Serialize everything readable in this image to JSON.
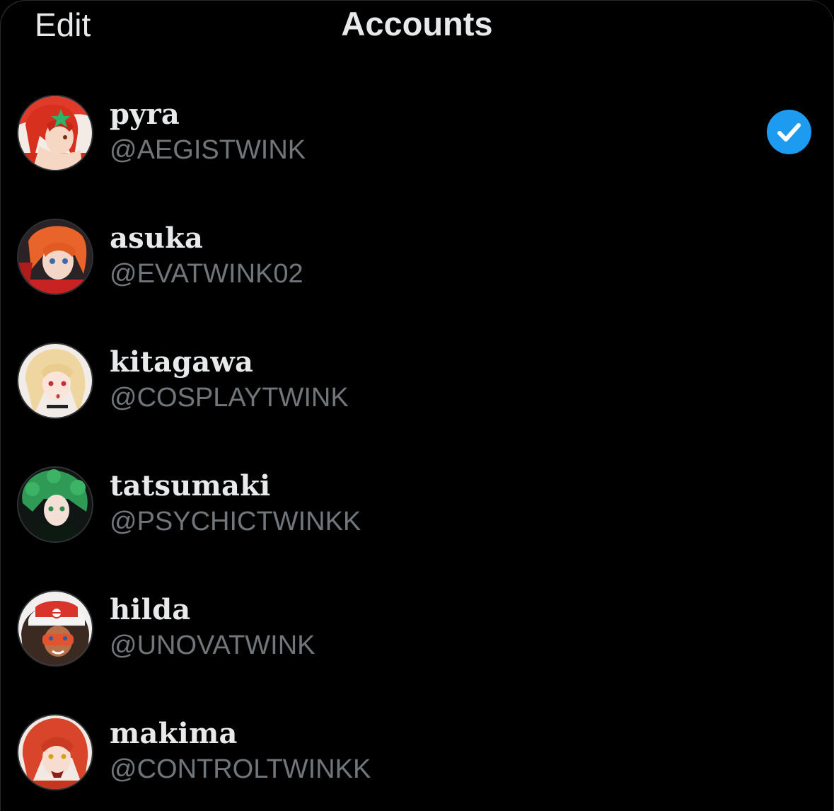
{
  "header": {
    "edit_label": "Edit",
    "title": "Accounts"
  },
  "colors": {
    "background": "#000000",
    "primary_text": "#e7e9ea",
    "secondary_text": "#71767b",
    "accent": "#1d9bf0"
  },
  "accounts": [
    {
      "name": "pyra",
      "handle": "@AEGISTWINK",
      "selected": true,
      "avatar_icon": "pyra-avatar"
    },
    {
      "name": "asuka",
      "handle": "@EVATWINK02",
      "selected": false,
      "avatar_icon": "asuka-avatar"
    },
    {
      "name": "kitagawa",
      "handle": "@COSPLAYTWINK",
      "selected": false,
      "avatar_icon": "kitagawa-avatar"
    },
    {
      "name": "tatsumaki",
      "handle": "@PSYCHICTWINKK",
      "selected": false,
      "avatar_icon": "tatsumaki-avatar"
    },
    {
      "name": "hilda",
      "handle": "@UNOVATWINK",
      "selected": false,
      "avatar_icon": "hilda-avatar"
    },
    {
      "name": "makima",
      "handle": "@CONTROLTWINKK",
      "selected": false,
      "avatar_icon": "makima-avatar"
    }
  ]
}
